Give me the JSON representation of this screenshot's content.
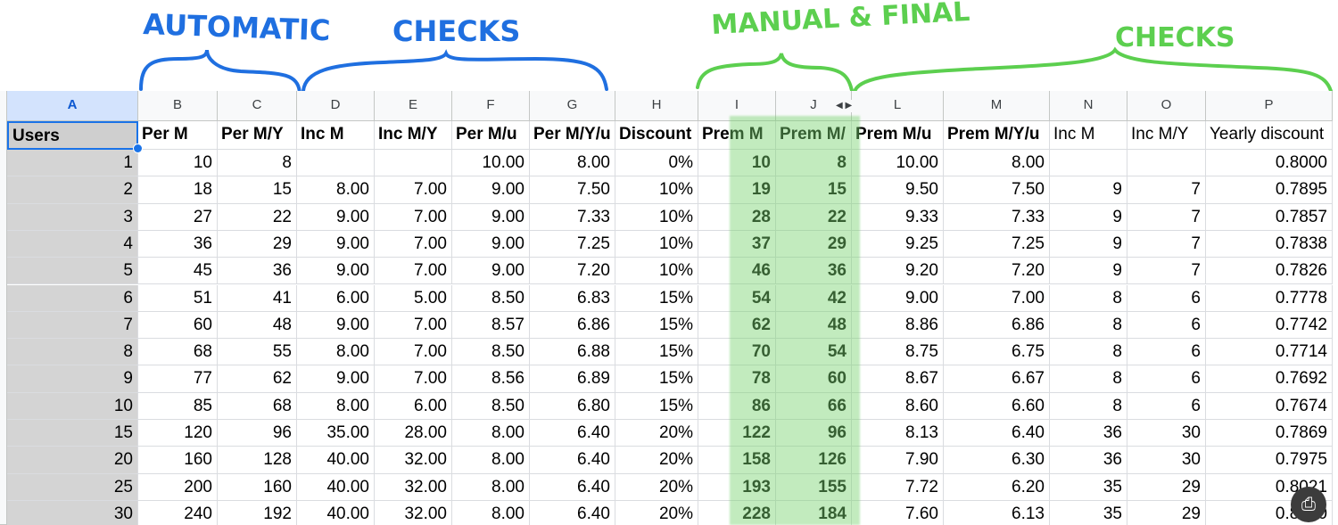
{
  "annotations": {
    "automatic_label": "AUTOMATIC",
    "checks1_label": "CHECKS",
    "manual_label": "MANUAL & FINAL",
    "checks2_label": "CHECKS",
    "blue_color": "#1f6fe0",
    "green_color": "#5ccf4f"
  },
  "sheet": {
    "column_letters": [
      "A",
      "B",
      "C",
      "D",
      "E",
      "F",
      "G",
      "H",
      "I",
      "J",
      "L",
      "M",
      "N",
      "O",
      "P"
    ],
    "headers": [
      "Users",
      "Per M",
      "Per M/Y",
      "Inc M",
      "Inc M/Y",
      "Per M/u",
      "Per M/Y/u",
      "Discount",
      "Prem M",
      "Prem M/",
      "Prem M/u",
      "Prem M/Y/u",
      "Inc M",
      "Inc M/Y",
      "Yearly discount"
    ],
    "rows": [
      [
        "1",
        "10",
        "8",
        "",
        "",
        "10.00",
        "8.00",
        "0%",
        "10",
        "8",
        "10.00",
        "8.00",
        "",
        "",
        "0.8000"
      ],
      [
        "2",
        "18",
        "15",
        "8.00",
        "7.00",
        "9.00",
        "7.50",
        "10%",
        "19",
        "15",
        "9.50",
        "7.50",
        "9",
        "7",
        "0.7895"
      ],
      [
        "3",
        "27",
        "22",
        "9.00",
        "7.00",
        "9.00",
        "7.33",
        "10%",
        "28",
        "22",
        "9.33",
        "7.33",
        "9",
        "7",
        "0.7857"
      ],
      [
        "4",
        "36",
        "29",
        "9.00",
        "7.00",
        "9.00",
        "7.25",
        "10%",
        "37",
        "29",
        "9.25",
        "7.25",
        "9",
        "7",
        "0.7838"
      ],
      [
        "5",
        "45",
        "36",
        "9.00",
        "7.00",
        "9.00",
        "7.20",
        "10%",
        "46",
        "36",
        "9.20",
        "7.20",
        "9",
        "7",
        "0.7826"
      ],
      [
        "6",
        "51",
        "41",
        "6.00",
        "5.00",
        "8.50",
        "6.83",
        "15%",
        "54",
        "42",
        "9.00",
        "7.00",
        "8",
        "6",
        "0.7778"
      ],
      [
        "7",
        "60",
        "48",
        "9.00",
        "7.00",
        "8.57",
        "6.86",
        "15%",
        "62",
        "48",
        "8.86",
        "6.86",
        "8",
        "6",
        "0.7742"
      ],
      [
        "8",
        "68",
        "55",
        "8.00",
        "7.00",
        "8.50",
        "6.88",
        "15%",
        "70",
        "54",
        "8.75",
        "6.75",
        "8",
        "6",
        "0.7714"
      ],
      [
        "9",
        "77",
        "62",
        "9.00",
        "7.00",
        "8.56",
        "6.89",
        "15%",
        "78",
        "60",
        "8.67",
        "6.67",
        "8",
        "6",
        "0.7692"
      ],
      [
        "10",
        "85",
        "68",
        "8.00",
        "6.00",
        "8.50",
        "6.80",
        "15%",
        "86",
        "66",
        "8.60",
        "6.60",
        "8",
        "6",
        "0.7674"
      ],
      [
        "15",
        "120",
        "96",
        "35.00",
        "28.00",
        "8.00",
        "6.40",
        "20%",
        "122",
        "96",
        "8.13",
        "6.40",
        "36",
        "30",
        "0.7869"
      ],
      [
        "20",
        "160",
        "128",
        "40.00",
        "32.00",
        "8.00",
        "6.40",
        "20%",
        "158",
        "126",
        "7.90",
        "6.30",
        "36",
        "30",
        "0.7975"
      ],
      [
        "25",
        "200",
        "160",
        "40.00",
        "32.00",
        "8.00",
        "6.40",
        "20%",
        "193",
        "155",
        "7.72",
        "6.20",
        "35",
        "29",
        "0.8021"
      ],
      [
        "30",
        "240",
        "192",
        "40.00",
        "32.00",
        "8.00",
        "6.40",
        "20%",
        "228",
        "184",
        "7.60",
        "6.13",
        "35",
        "29",
        "0.8000"
      ]
    ]
  },
  "icons": {
    "hidden_columns": "hidden-columns-arrows-icon",
    "overlay": "screenshot-tool-icon"
  }
}
